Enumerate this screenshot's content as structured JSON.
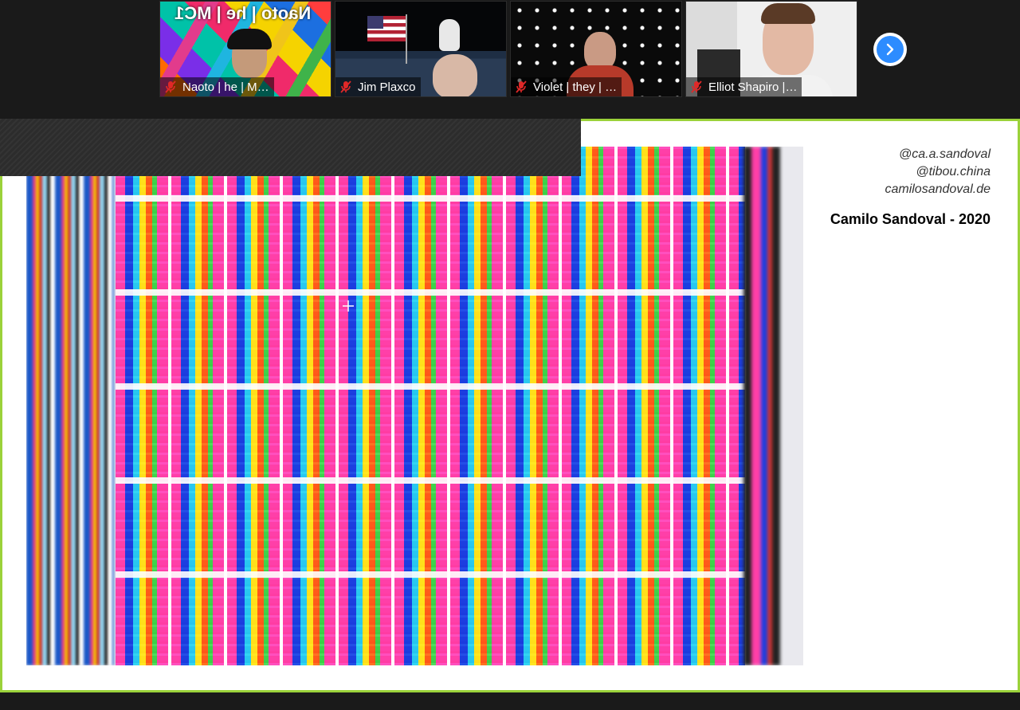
{
  "participants": [
    {
      "name": "Naoto | he | M…",
      "background_text": "Naoto | he | MC1",
      "muted": true
    },
    {
      "name": "Jim Plaxco",
      "muted": true
    },
    {
      "name": "Violet | they | …",
      "muted": true
    },
    {
      "name": "Elliot Shapiro |…",
      "muted": true
    }
  ],
  "nav": {
    "next_icon": "chevron-right-icon"
  },
  "slide": {
    "handles": [
      "@ca.a.sandoval",
      "@tibou.china",
      "camilosandoval.de"
    ],
    "title": "Camilo Sandoval - 2020"
  },
  "colors": {
    "share_border": "#9bd23a",
    "accent": "#2d8cff",
    "mute": "#e02828"
  }
}
